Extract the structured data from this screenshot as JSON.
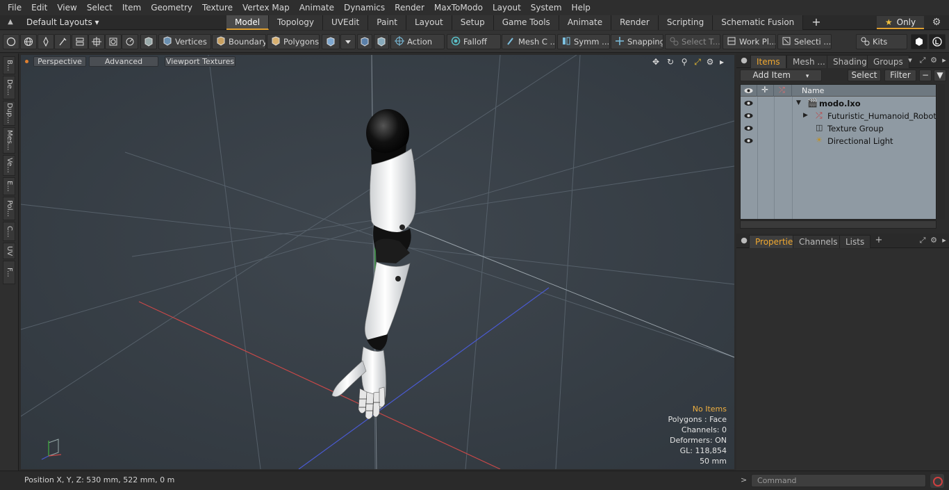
{
  "menubar": [
    "File",
    "Edit",
    "View",
    "Select",
    "Item",
    "Geometry",
    "Texture",
    "Vertex Map",
    "Animate",
    "Dynamics",
    "Render",
    "MaxToModo",
    "Layout",
    "System",
    "Help"
  ],
  "layoutbar": {
    "layout_name": "Default Layouts ▾",
    "tabs": [
      "Model",
      "Topology",
      "UVEdit",
      "Paint",
      "Layout",
      "Setup",
      "Game Tools",
      "Animate",
      "Render",
      "Scripting",
      "Schematic Fusion"
    ],
    "active_tab": "Model",
    "plus": "+",
    "only_label": "Only"
  },
  "toolbar": {
    "vertices": "Vertices",
    "boundary": "Boundary",
    "polygons": "Polygons",
    "action": "Action",
    "falloff": "Falloff",
    "mesh_c": "Mesh C ...",
    "symm": "Symm ...",
    "snapping": "Snapping",
    "select_t": "Select T...",
    "work_pl": "Work Pl...",
    "selecti": "Selecti ...",
    "kits": "Kits"
  },
  "leftstrip": [
    "B...",
    "De...",
    "Dup...",
    "Mes...",
    "Ve...",
    "E...",
    "Pol...",
    "C...",
    "UV",
    "F..."
  ],
  "viewport": {
    "perspective": "Perspective",
    "advanced": "Advanced",
    "viewport_textures": "Viewport Textures",
    "info": {
      "no_items": "No Items",
      "polygons": "Polygons : Face",
      "channels": "Channels: 0",
      "deformers": "Deformers: ON",
      "gl": "GL: 118,854",
      "scale": "50 mm"
    }
  },
  "items_panel": {
    "tabs": [
      "Items",
      "Mesh ...",
      "Shading",
      "Groups"
    ],
    "active_tab": "Items",
    "add_item": "Add Item",
    "select": "Select",
    "filter": "Filter",
    "name_header": "Name",
    "rows": [
      "modo.lxo",
      "Futuristic_Humanoid_Robot_ ...",
      "Texture Group",
      "Directional Light"
    ]
  },
  "props_panel": {
    "tabs": [
      "Properties",
      "Channels",
      "Lists"
    ],
    "active_tab": "Properties",
    "plus": "+"
  },
  "statusbar": {
    "position": "Position X, Y, Z:   530 mm, 522 mm, 0 m",
    "command_placeholder": "Command",
    "arrow": ">"
  },
  "colors": {
    "accent": "#e0a030",
    "viewport_bg": "#384048",
    "items_bg": "#8f9aa3"
  }
}
